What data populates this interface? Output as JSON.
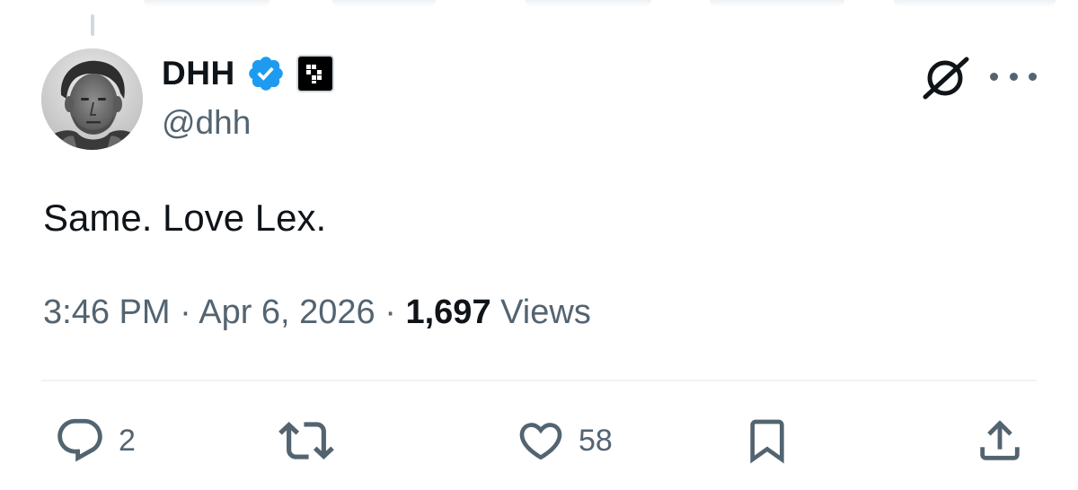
{
  "tweet": {
    "author": {
      "display_name": "DHH",
      "handle": "@dhh",
      "verified": true
    },
    "text": "Same. Love Lex.",
    "time": "3:46 PM",
    "separator": "·",
    "date": "Apr 6, 2026",
    "views_count": "1,697",
    "views_label": "Views"
  },
  "actions": {
    "replies": "2",
    "reposts": "",
    "likes": "58"
  },
  "colors": {
    "text": "#0f1419",
    "secondary": "#536471",
    "verified_blue": "#1d9bf0",
    "divider": "#eff3f4"
  },
  "icons": {
    "verified": "verified-badge-icon",
    "affiliate": "affiliate-badge-icon",
    "grok": "grok-icon",
    "more": "more-icon",
    "reply": "reply-icon",
    "repost": "repost-icon",
    "like": "heart-icon",
    "bookmark": "bookmark-icon",
    "share": "share-icon"
  }
}
